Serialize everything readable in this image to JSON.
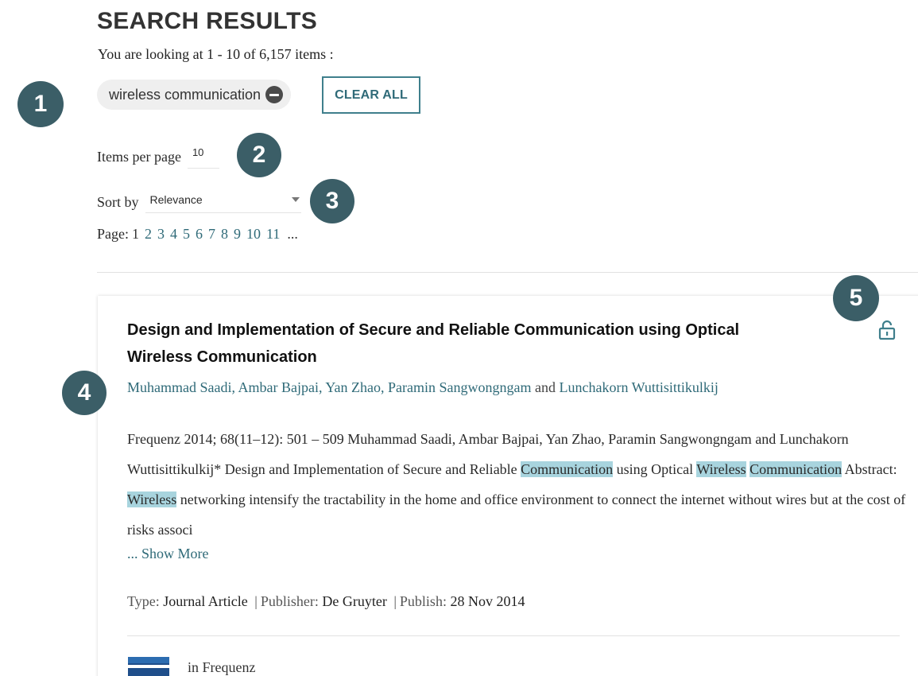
{
  "header": {
    "title": "SEARCH RESULTS",
    "summary": "You are looking at 1 - 10 of 6,157 items :"
  },
  "filters": {
    "chip_label": "wireless communication",
    "clear_all_label": "CLEAR ALL"
  },
  "controls": {
    "items_per_page_label": "Items per page",
    "items_per_page_value": "10",
    "sort_by_label": "Sort by",
    "sort_by_value": "Relevance"
  },
  "pagination": {
    "label": "Page:",
    "current": "1",
    "pages": [
      "2",
      "3",
      "4",
      "5",
      "6",
      "7",
      "8",
      "9",
      "10",
      "11"
    ],
    "ellipsis": "..."
  },
  "result": {
    "title_line1": "Design and Implementation of Secure and Reliable Communication using Optical",
    "title_line2": "Wireless Communication",
    "access_icon": "unlock-icon",
    "authors": [
      "Muhammad Saadi",
      "Ambar Bajpai",
      "Yan Zhao",
      "Paramin Sangwongngam"
    ],
    "authors_last": "Lunchakorn Wuttisittikulkij",
    "authors_sep": ", ",
    "authors_and": " and ",
    "snippet": {
      "s1": "Frequenz 2014; 68(11–12): 501 – 509 Muhammad Saadi, Ambar Bajpai, Yan Zhao, Paramin Sangwongngam and Lunchakorn Wuttisittikulkij* Design and Implementation of Secure and Reliable ",
      "h1": "Communication",
      "s2": " using Optical ",
      "h2": "Wireless",
      "s3": " ",
      "h3": "Communication",
      "s4": " Abstract: ",
      "h4": "Wireless",
      "s5": " networking intensify the tractability in the home and office environment to connect the internet without wires but at the cost of risks associ"
    },
    "show_more": "... Show More",
    "meta": {
      "type_label": "Type:",
      "type_value": "Journal Article",
      "publisher_label": "Publisher:",
      "publisher_value": "De Gruyter",
      "publish_label": "Publish:",
      "publish_value": "28 Nov 2014",
      "separator": "|"
    },
    "in_journal": "in Frequenz"
  },
  "markers": [
    "1",
    "2",
    "3",
    "4",
    "5"
  ],
  "colors": {
    "accent": "#2f6a78",
    "marker": "#3b5e67",
    "highlight": "#a8d4de"
  }
}
